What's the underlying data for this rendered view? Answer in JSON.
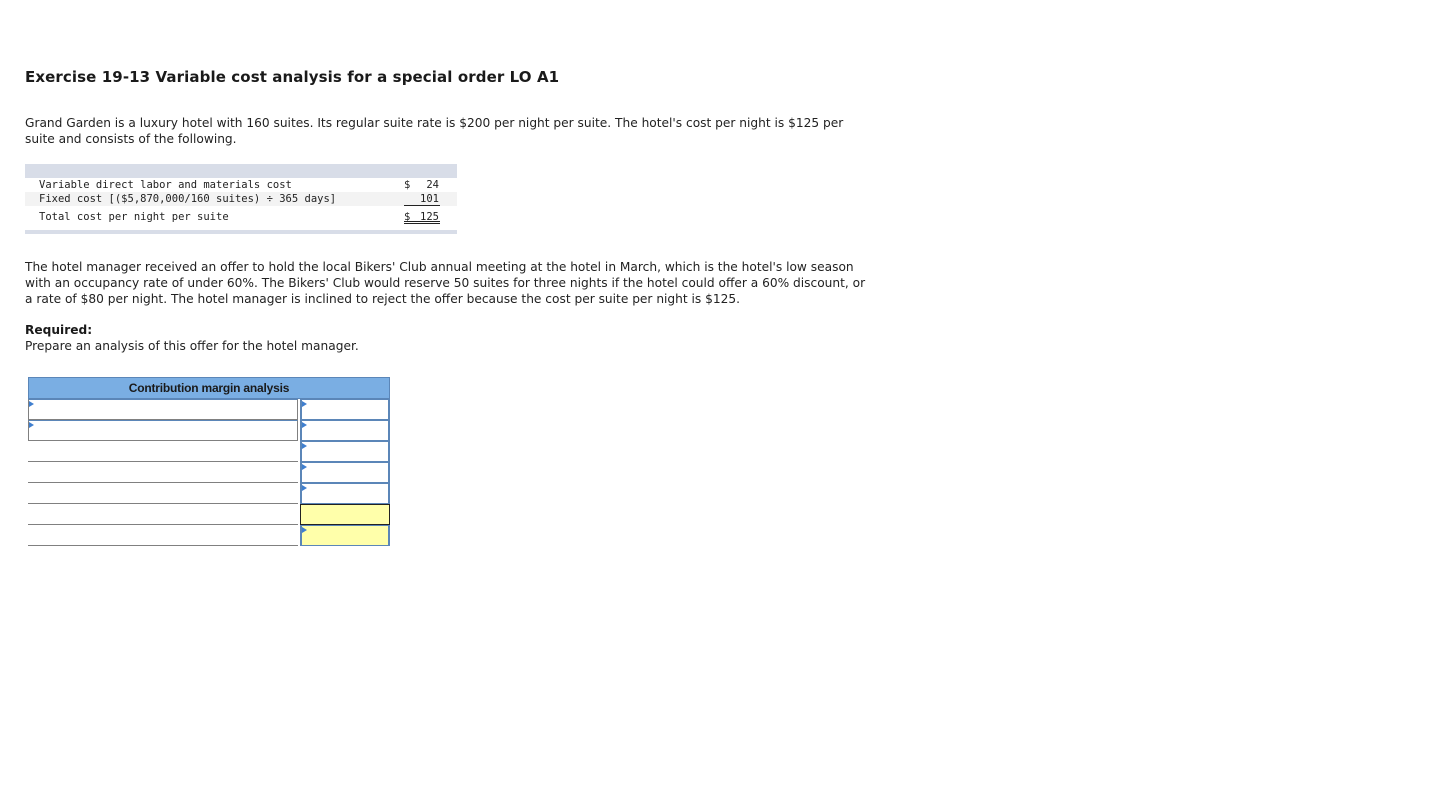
{
  "title": "Exercise 19-13 Variable cost analysis for a special order LO A1",
  "intro": "Grand Garden is a luxury hotel with 160 suites. Its regular suite rate is $200 per night per suite. The hotel's cost per night is $125 per suite and consists of the following.",
  "cost_table": {
    "rows": [
      {
        "label": "Variable direct labor and materials cost",
        "currency": "$",
        "amount": "24"
      },
      {
        "label": "Fixed cost [($5,870,000/160 suites) ÷ 365 days]",
        "currency": "",
        "amount": "101"
      }
    ],
    "total": {
      "label": "Total cost per night per suite",
      "currency": "$",
      "amount": "125"
    }
  },
  "scenario": "The hotel manager received an offer to hold the local Bikers' Club annual meeting at the hotel in March, which is the hotel's low season with an occupancy rate of under 60%. The Bikers' Club would reserve 50 suites for three nights if the hotel could offer a 60% discount, or a rate of $80 per night. The hotel manager is inclined to reject the offer because the cost per suite per night is $125.",
  "required_label": "Required:",
  "required_text": "Prepare an analysis of this offer for the hotel manager.",
  "cm_table": {
    "header": "Contribution margin analysis",
    "rows": [
      {
        "label": "",
        "value": ""
      },
      {
        "label": "",
        "value": ""
      },
      {
        "label": "",
        "value": ""
      },
      {
        "label": "",
        "value": ""
      },
      {
        "label": "",
        "value": ""
      },
      {
        "label": "",
        "value": ""
      },
      {
        "label": "",
        "value": ""
      }
    ]
  }
}
